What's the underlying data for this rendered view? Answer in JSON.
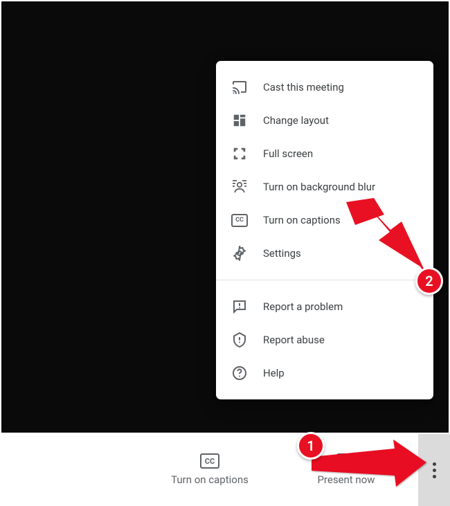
{
  "menu": {
    "section1": [
      {
        "label": "Cast this meeting"
      },
      {
        "label": "Change layout"
      },
      {
        "label": "Full screen"
      },
      {
        "label": "Turn on background blur"
      },
      {
        "label": "Turn on captions"
      },
      {
        "label": "Settings"
      }
    ],
    "section2": [
      {
        "label": "Report a problem"
      },
      {
        "label": "Report abuse"
      },
      {
        "label": "Help"
      }
    ]
  },
  "bottom_bar": {
    "captions_label": "Turn on captions",
    "present_label": "Present now"
  },
  "annotations": {
    "badge1": "1",
    "badge2": "2"
  }
}
